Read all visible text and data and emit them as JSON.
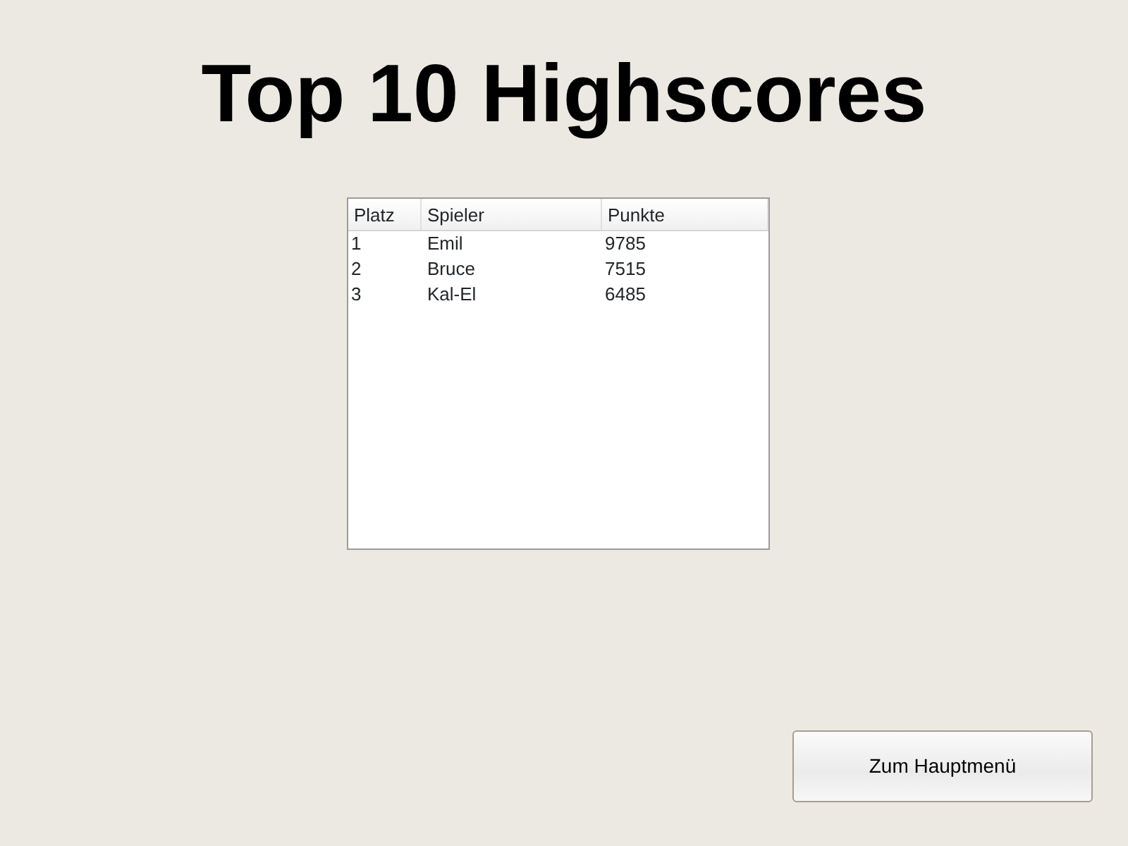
{
  "title": "Top 10 Highscores",
  "table": {
    "columns": [
      "Platz",
      "Spieler",
      "Punkte"
    ],
    "rows": [
      [
        "1",
        "Emil",
        "9785"
      ],
      [
        "2",
        "Bruce",
        "7515"
      ],
      [
        "3",
        "Kal-El",
        "6485"
      ]
    ]
  },
  "buttons": [
    "Zum Hauptmenü"
  ]
}
